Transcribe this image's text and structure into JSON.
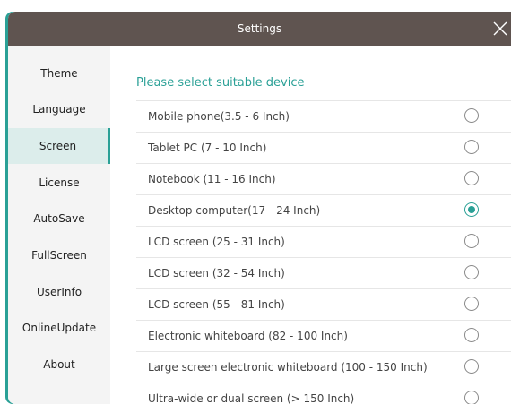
{
  "window": {
    "title": "Settings"
  },
  "sidebar": {
    "items": [
      {
        "label": "Theme",
        "active": false
      },
      {
        "label": "Language",
        "active": false
      },
      {
        "label": "Screen",
        "active": true
      },
      {
        "label": "License",
        "active": false
      },
      {
        "label": "AutoSave",
        "active": false
      },
      {
        "label": "FullScreen",
        "active": false
      },
      {
        "label": "UserInfo",
        "active": false
      },
      {
        "label": "OnlineUpdate",
        "active": false
      },
      {
        "label": "About",
        "active": false
      }
    ]
  },
  "screen": {
    "heading": "Please select suitable device",
    "devices": [
      {
        "label": "Mobile phone(3.5 - 6 Inch)",
        "selected": false
      },
      {
        "label": "Tablet PC (7 - 10 Inch)",
        "selected": false
      },
      {
        "label": "Notebook  (11 - 16 Inch)",
        "selected": false
      },
      {
        "label": "Desktop computer(17 - 24 Inch)",
        "selected": true
      },
      {
        "label": "LCD screen (25 - 31 Inch)",
        "selected": false
      },
      {
        "label": "LCD screen (32 - 54 Inch)",
        "selected": false
      },
      {
        "label": "LCD screen (55 - 81 Inch)",
        "selected": false
      },
      {
        "label": "Electronic whiteboard (82 - 100 Inch)",
        "selected": false
      },
      {
        "label": "Large screen electronic whiteboard (100 - 150 Inch)",
        "selected": false
      },
      {
        "label": "Ultra-wide or dual screen (> 150 Inch)",
        "selected": false
      }
    ]
  },
  "colors": {
    "accent": "#2aa096",
    "titlebar": "#5f5450",
    "sidebar_bg": "#f4f4f4",
    "active_item_bg": "#dcedeb"
  },
  "icons": {
    "close": "close-icon"
  }
}
